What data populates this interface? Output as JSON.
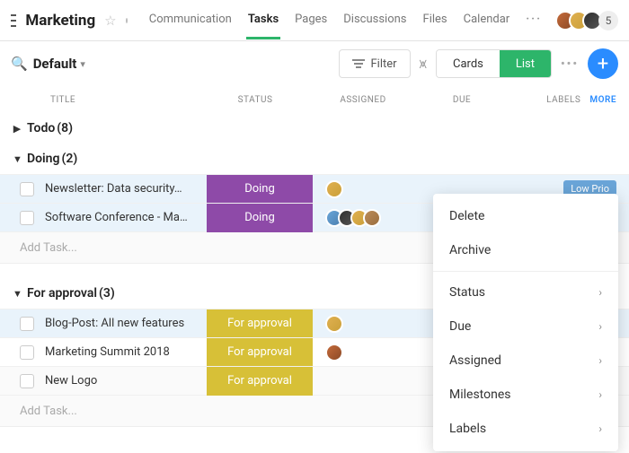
{
  "header": {
    "title": "Marketing",
    "additional_count": "5",
    "tabs": [
      {
        "label": "Communication",
        "active": false
      },
      {
        "label": "Tasks",
        "active": true
      },
      {
        "label": "Pages",
        "active": false
      },
      {
        "label": "Discussions",
        "active": false
      },
      {
        "label": "Files",
        "active": false
      },
      {
        "label": "Calendar",
        "active": false
      }
    ]
  },
  "toolbar": {
    "view_name": "Default",
    "filter_label": "Filter",
    "seg_cards": "Cards",
    "seg_list": "List",
    "active_seg": "list"
  },
  "columns": {
    "title": "TITLE",
    "status": "STATUS",
    "assigned": "ASSIGNED",
    "due": "DUE",
    "labels": "LABELS",
    "more": "MORE"
  },
  "add_task_placeholder": "Add Task...",
  "groups": [
    {
      "name": "Todo",
      "count": 8,
      "expanded": false,
      "rows": []
    },
    {
      "name": "Doing",
      "count": 2,
      "expanded": true,
      "rows": [
        {
          "title": "Newsletter: Data security…",
          "status": "Doing",
          "status_class": "doing",
          "assignees": [
            "a2"
          ],
          "label": "Low Prio",
          "selected": true
        },
        {
          "title": "Software Conference - Ma…",
          "status": "Doing",
          "status_class": "doing",
          "assignees": [
            "a4",
            "a3",
            "a2",
            "a5"
          ],
          "label": null,
          "selected": true
        }
      ]
    },
    {
      "name": "For approval",
      "count": 3,
      "expanded": true,
      "rows": [
        {
          "title": "Blog-Post: All new features",
          "status": "For approval",
          "status_class": "approval",
          "assignees": [
            "a2"
          ],
          "label": null,
          "selected": true
        },
        {
          "title": "Marketing Summit 2018",
          "status": "For approval",
          "status_class": "approval",
          "assignees": [
            "a1"
          ],
          "label": null,
          "selected": false
        },
        {
          "title": "New Logo",
          "status": "For approval",
          "status_class": "approval",
          "assignees": [],
          "label": null,
          "selected": false
        }
      ]
    }
  ],
  "context_menu": {
    "items": [
      {
        "label": "Delete",
        "submenu": false
      },
      {
        "label": "Archive",
        "submenu": false
      },
      {
        "sep": true
      },
      {
        "label": "Status",
        "submenu": true
      },
      {
        "label": "Due",
        "submenu": true
      },
      {
        "label": "Assigned",
        "submenu": true
      },
      {
        "label": "Milestones",
        "submenu": true
      },
      {
        "label": "Labels",
        "submenu": true
      }
    ]
  }
}
